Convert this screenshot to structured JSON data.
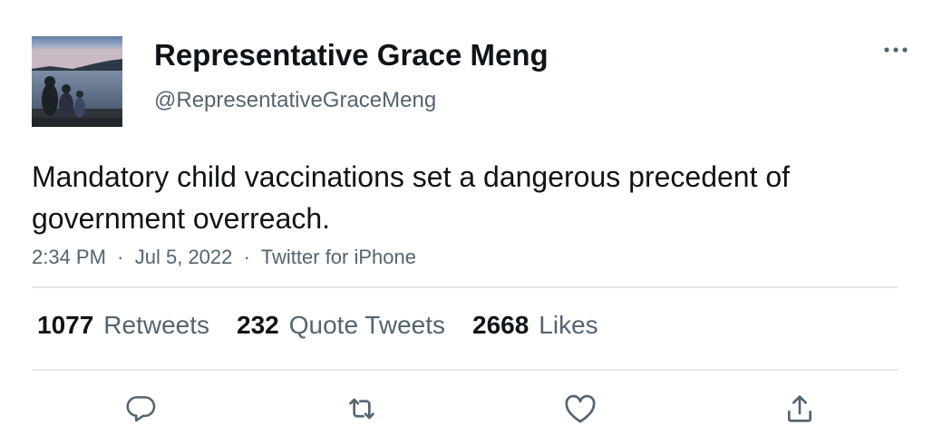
{
  "author": {
    "display_name": "Representative Grace Meng",
    "handle": "@RepresentativeGraceMeng",
    "avatar_icon": "profile-photo-lake-family"
  },
  "tweet": {
    "text": "Mandatory child vaccinations set a dangerous precedent of government overreach.",
    "time": "2:34 PM",
    "date": "Jul 5, 2022",
    "source": "Twitter for iPhone",
    "separator": "·"
  },
  "stats": {
    "retweets": {
      "count": "1077",
      "label": "Retweets"
    },
    "quote_tweets": {
      "count": "232",
      "label": "Quote Tweets"
    },
    "likes": {
      "count": "2668",
      "label": "Likes"
    }
  },
  "actions": {
    "reply_icon": "reply-icon",
    "retweet_icon": "retweet-icon",
    "like_icon": "like-icon",
    "share_icon": "share-icon",
    "more_icon": "more-icon"
  },
  "colors": {
    "text_primary": "#0f1419",
    "text_secondary": "#536471",
    "divider": "#e1e6ea",
    "background": "#ffffff"
  }
}
